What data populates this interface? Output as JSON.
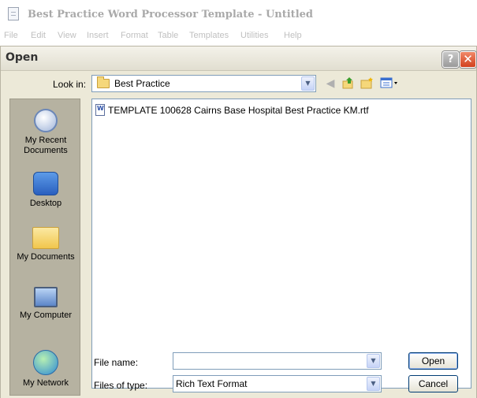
{
  "app": {
    "title": "Best Practice Word Processor Template - Untitled",
    "menu": [
      "File",
      "Edit",
      "View",
      "Insert",
      "Format",
      "Table",
      "Templates",
      "Utilities",
      "Help"
    ]
  },
  "dialog": {
    "title": "Open",
    "help_label": "?",
    "close_label": "✕",
    "look_in_label": "Look in:",
    "look_in_value": "Best Practice"
  },
  "toolbar": {
    "back_icon": "back-icon",
    "up_icon": "up-folder-icon",
    "new_folder_icon": "new-folder-icon",
    "views_icon": "views-menu-icon"
  },
  "places": [
    {
      "label": "My Recent Documents",
      "icon": "my-recent-documents-icon"
    },
    {
      "label": "Desktop",
      "icon": "desktop-icon"
    },
    {
      "label": "My Documents",
      "icon": "my-documents-icon"
    },
    {
      "label": "My Computer",
      "icon": "my-computer-icon"
    },
    {
      "label": "My Network",
      "icon": "my-network-icon"
    }
  ],
  "files": [
    {
      "name": "TEMPLATE 100628 Cairns Base Hospital Best Practice KM.rtf",
      "icon": "rtf-document-icon"
    }
  ],
  "form": {
    "file_name_label": "File name:",
    "file_name_value": "",
    "file_type_label": "Files of type:",
    "file_type_value": "Rich Text Format",
    "open_label": "Open",
    "cancel_label": "Cancel"
  },
  "colors": {
    "dialog_bg": "#ece9d8",
    "places_bg": "#b6b2a1",
    "field_border": "#7f9db9",
    "close_red": "#d2401e"
  }
}
